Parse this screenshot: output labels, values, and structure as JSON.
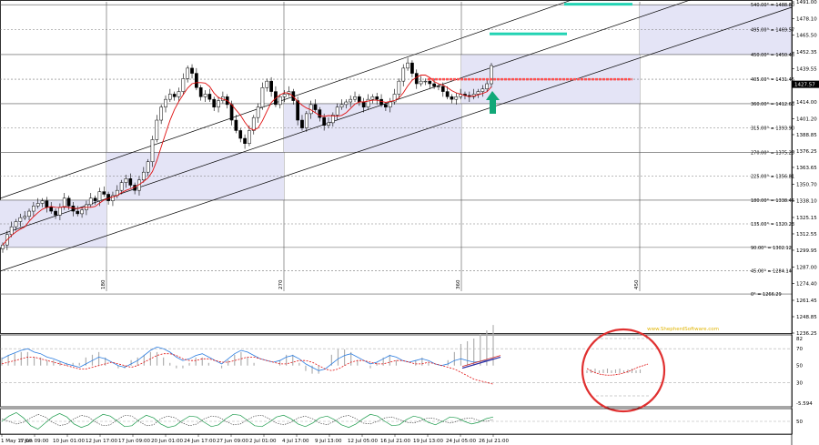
{
  "chart_data": {
    "type": "candlestick",
    "y_axis_price": {
      "min": 1236.25,
      "max": 1491.0,
      "ticks": [
        1491.0,
        1478.1,
        1465.5,
        1452.35,
        1439.55,
        1427.57,
        1414.0,
        1401.2,
        1388.85,
        1376.25,
        1363.65,
        1350.7,
        1338.1,
        1325.15,
        1312.55,
        1299.95,
        1287.0,
        1274.4,
        1261.45,
        1248.85,
        1236.25
      ],
      "current_price_label": "1427.57"
    },
    "time_labels": [
      "1 May 17:00",
      "5 Jun 09:00",
      "10 Jun 01:00",
      "12 Jun 17:00",
      "17 Jun 09:00",
      "20 Jun 01:00",
      "24 Jun 17:00",
      "27 Jun 09:00",
      "2 Jul 01:00",
      "4 Jul 17:00",
      "9 Jul 13:00",
      "12 Jul 05:00",
      "16 Jul 21:00",
      "19 Jul 13:00",
      "24 Jul 05:00",
      "26 Jul 21:00"
    ],
    "cycle_markers": [
      "180",
      "270",
      "360",
      "450"
    ],
    "gann_levels": [
      {
        "label": "540.00° = 1488.80",
        "price": 1488.8
      },
      {
        "label": "495.00° = 1469.57",
        "price": 1469.57
      },
      {
        "label": "450.00° = 1450.48",
        "price": 1450.48
      },
      {
        "label": "405.00° = 1431.45",
        "price": 1431.45
      },
      {
        "label": "360.00° = 1412.63",
        "price": 1412.63
      },
      {
        "label": "315.00° = 1393.90",
        "price": 1393.9
      },
      {
        "label": "270.00° = 1375.29",
        "price": 1375.29
      },
      {
        "label": "225.00° = 1356.81",
        "price": 1356.81
      },
      {
        "label": "180.00° = 1338.46",
        "price": 1338.46
      },
      {
        "label": "135.00° = 1320.23",
        "price": 1320.23
      },
      {
        "label": "90.00° = 1302.12",
        "price": 1302.12
      },
      {
        "label": "45.00° = 1284.14",
        "price": 1284.14
      },
      {
        "label": "0° = 1266.29",
        "price": 1266.29
      }
    ],
    "watermark": "www.ShepherdSoftware.com",
    "price_close": [
      1304,
      1312,
      1318,
      1322,
      1325,
      1326,
      1330,
      1334,
      1336,
      1338,
      1333,
      1330,
      1327,
      1333,
      1340,
      1334,
      1330,
      1328,
      1331,
      1335,
      1340,
      1338,
      1345,
      1343,
      1338,
      1342,
      1346,
      1352,
      1355,
      1350,
      1346,
      1354,
      1360,
      1368,
      1385,
      1400,
      1410,
      1416,
      1420,
      1418,
      1422,
      1432,
      1440,
      1436,
      1425,
      1418,
      1420,
      1416,
      1410,
      1415,
      1418,
      1412,
      1400,
      1392,
      1386,
      1382,
      1392,
      1402,
      1410,
      1425,
      1430,
      1422,
      1412,
      1418,
      1420,
      1422,
      1415,
      1400,
      1394,
      1405,
      1412,
      1408,
      1402,
      1396,
      1398,
      1404,
      1410,
      1412,
      1414,
      1416,
      1418,
      1414,
      1410,
      1416,
      1418,
      1416,
      1412,
      1410,
      1414,
      1420,
      1430,
      1440,
      1444,
      1436,
      1428,
      1430,
      1430,
      1428,
      1426,
      1426,
      1422,
      1418,
      1416,
      1418,
      1420,
      1419,
      1418,
      1420,
      1422,
      1424,
      1428,
      1442
    ],
    "indicator1": {
      "ticks": [
        82,
        70,
        50,
        30,
        5.594
      ],
      "tick_labels": [
        "82",
        "70",
        "50",
        "30",
        "-5.594"
      ],
      "blue": [
        58,
        62,
        65,
        68,
        70,
        66,
        64,
        60,
        58,
        55,
        52,
        50,
        48,
        52,
        56,
        60,
        58,
        54,
        50,
        48,
        52,
        56,
        62,
        68,
        72,
        70,
        66,
        60,
        56,
        58,
        62,
        64,
        60,
        56,
        52,
        58,
        64,
        68,
        66,
        62,
        58,
        56,
        54,
        56,
        60,
        62,
        58,
        52,
        48,
        44,
        46,
        52,
        58,
        62,
        64,
        60,
        56,
        52,
        54,
        58,
        62,
        60,
        56,
        54,
        56,
        58,
        56,
        52,
        50,
        52,
        56,
        58,
        56,
        54,
        55,
        56,
        58
      ],
      "red": [
        52,
        54,
        56,
        58,
        60,
        60,
        58,
        56,
        54,
        52,
        50,
        48,
        46,
        46,
        48,
        50,
        52,
        54,
        52,
        50,
        48,
        50,
        54,
        58,
        62,
        64,
        64,
        62,
        58,
        56,
        56,
        58,
        58,
        56,
        54,
        54,
        56,
        58,
        60,
        60,
        58,
        56,
        54,
        52,
        52,
        54,
        56,
        56,
        54,
        50,
        46,
        44,
        46,
        50,
        54,
        56,
        56,
        54,
        52,
        52,
        54,
        56,
        56,
        54,
        52,
        52,
        54,
        52,
        50,
        48,
        46,
        42,
        38,
        34,
        32,
        30,
        28
      ]
    },
    "indicator2": {
      "ticks": [
        50
      ],
      "tick_labels": [
        "50"
      ],
      "series_a": [
        50,
        62,
        70,
        58,
        40,
        32,
        46,
        60,
        68,
        60,
        44,
        36,
        42,
        56,
        66,
        62,
        50,
        38,
        40,
        54,
        64,
        58,
        44,
        36,
        40,
        52,
        62,
        60,
        48,
        38,
        42,
        56,
        66,
        64,
        52,
        40,
        38,
        48,
        60,
        64,
        56,
        44,
        38,
        46,
        58,
        62,
        54,
        42,
        36,
        44,
        56,
        66,
        62,
        50,
        40,
        42,
        54,
        62,
        58,
        48,
        42,
        50,
        60,
        58,
        50,
        44,
        48,
        56,
        60
      ],
      "series_b": [
        56,
        50,
        44,
        48,
        58,
        66,
        60,
        48,
        40,
        44,
        56,
        64,
        60,
        48,
        40,
        42,
        54,
        64,
        62,
        50,
        40,
        42,
        56,
        62,
        58,
        46,
        40,
        44,
        56,
        62,
        60,
        50,
        42,
        44,
        54,
        62,
        64,
        56,
        46,
        42,
        48,
        58,
        62,
        56,
        46,
        42,
        50,
        60,
        64,
        56,
        46,
        44,
        50,
        58,
        60,
        54,
        48,
        46,
        52,
        58,
        56,
        50,
        46,
        50,
        56,
        58,
        52,
        50,
        54
      ]
    }
  }
}
